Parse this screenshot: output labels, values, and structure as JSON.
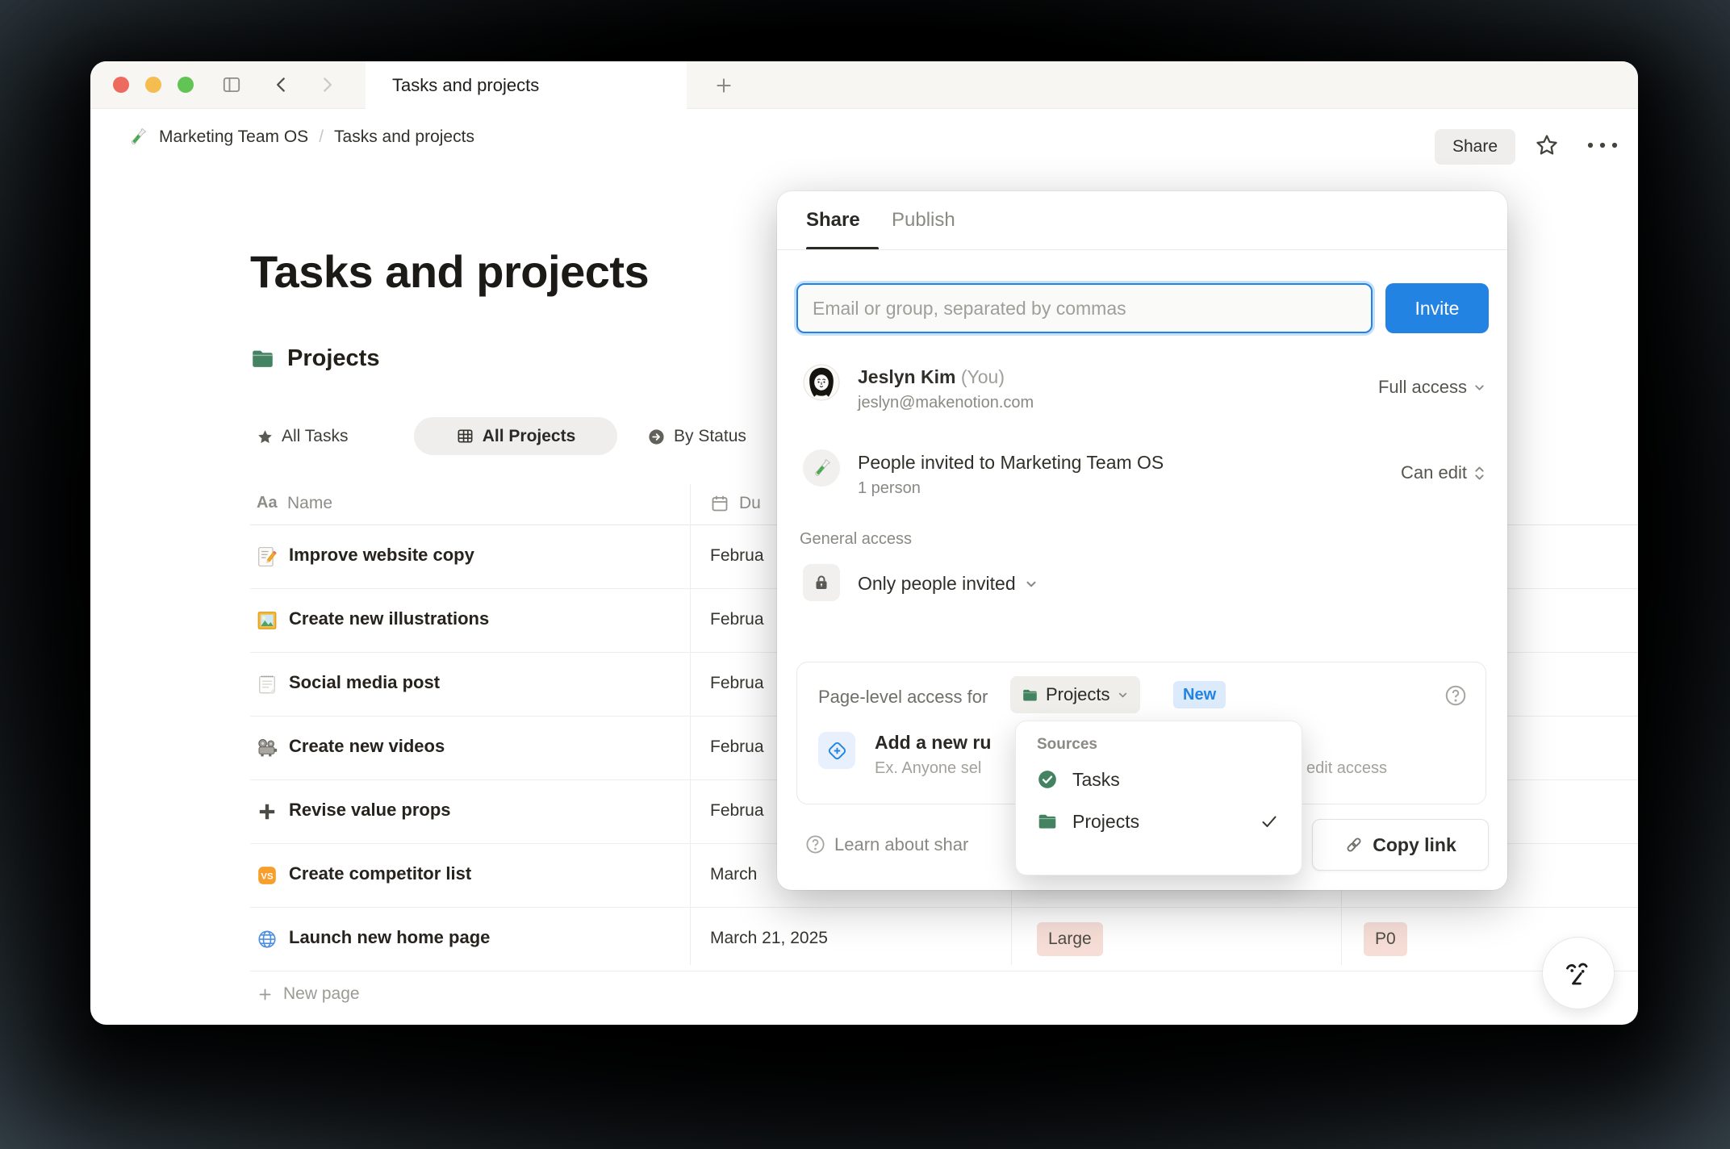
{
  "titlebar": {
    "tab_title": "Tasks and projects",
    "icons": {
      "sidebar": "sidebar-toggle-icon",
      "back": "chevron-left-icon",
      "forward": "chevron-right-icon",
      "new_tab": "plus-icon"
    }
  },
  "breadcrumb": {
    "workspace_icon": "test-tube-icon",
    "workspace": "Marketing Team OS",
    "separator": "/",
    "page": "Tasks and projects"
  },
  "topbar_actions": {
    "share": "Share",
    "favorite_icon": "star-outline-icon",
    "more_icon": "ellipsis-icon"
  },
  "page": {
    "title": "Tasks and projects",
    "collection_icon": "folder-icon",
    "collection_title": "Projects"
  },
  "views": {
    "items": [
      {
        "icon": "star-filled-icon",
        "label": "All Tasks",
        "active": false
      },
      {
        "icon": "table-icon",
        "label": "All Projects",
        "active": true
      },
      {
        "icon": "arrow-circle-icon",
        "label": "By Status",
        "active": false
      }
    ]
  },
  "table": {
    "headers": {
      "name": {
        "icon": "text-style-icon",
        "label": "Name"
      },
      "due": {
        "icon": "calendar-icon",
        "label": "Du"
      }
    },
    "rows": [
      {
        "icon": "memo-icon",
        "name": "Improve website copy",
        "due": "Februa"
      },
      {
        "icon": "picture-icon",
        "name": "Create new illustrations",
        "due": "Februa"
      },
      {
        "icon": "notepad-icon",
        "name": "Social media post",
        "due": "Februa"
      },
      {
        "icon": "projector-icon",
        "name": "Create new videos",
        "due": "Februa"
      },
      {
        "icon": "plus-bold-icon",
        "name": "Revise value props",
        "due": "Februa"
      },
      {
        "icon": "vs-icon",
        "name": "Create competitor list",
        "due": "March"
      },
      {
        "icon": "globe-icon",
        "name": "Launch new home page",
        "due": "March 21, 2025",
        "size": "Large",
        "priority": "P0"
      }
    ],
    "new_page": "New page"
  },
  "share_dialog": {
    "tabs": {
      "share": "Share",
      "publish": "Publish"
    },
    "invite_placeholder": "Email or group, separated by commas",
    "invite_button": "Invite",
    "owner": {
      "name": "Jeslyn Kim",
      "you": "(You)",
      "email": "jeslyn@makenotion.com",
      "access": "Full access"
    },
    "team": {
      "icon": "test-tube-icon",
      "name": "People invited to Marketing Team OS",
      "meta": "1 person",
      "access": "Can edit"
    },
    "general_access": {
      "heading": "General access",
      "icon": "lock-icon",
      "value": "Only people invited"
    },
    "page_access": {
      "label": "Page-level access for",
      "selector": "Projects",
      "selector_icon": "folder-icon",
      "badge": "New",
      "help_icon": "question-circle-icon",
      "rule_icon": "diamond-plus-icon",
      "rule_title": "Add a new ru",
      "rule_hint": "Ex. Anyone sel",
      "rule_hint_fragment": "edit access"
    },
    "footer": {
      "learn_icon": "question-circle-icon",
      "learn": "Learn about shar",
      "copy_icon": "link-icon",
      "copy_link": "Copy link"
    }
  },
  "sources_menu": {
    "heading": "Sources",
    "items": [
      {
        "icon": "circle-check-icon",
        "label": "Tasks",
        "checked": false
      },
      {
        "icon": "folder-icon",
        "label": "Projects",
        "checked": true
      }
    ]
  },
  "ai_button_icon": "notion-face-icon",
  "colors": {
    "accent_blue": "#2383e2",
    "notion_green": "#448361",
    "badge_pink_bg": "#f6ded7",
    "badge_blue_bg": "#dcebfb",
    "traffic_lights": [
      "#ed6a5e",
      "#f5bd4f",
      "#61c455"
    ]
  }
}
